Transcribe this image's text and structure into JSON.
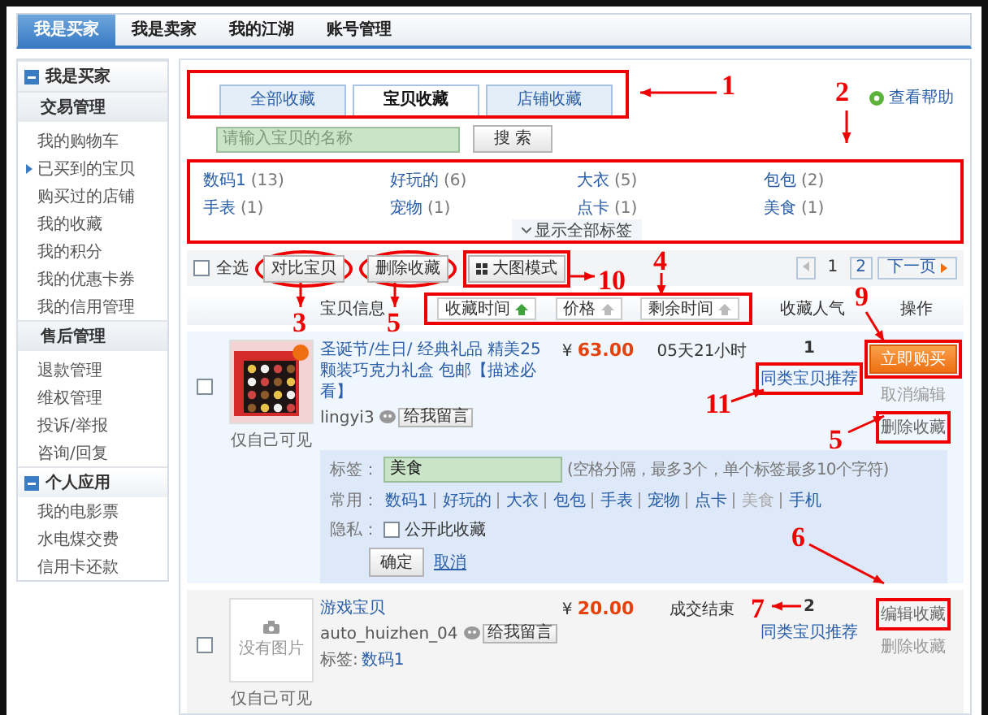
{
  "top_nav": [
    {
      "label": "我是买家",
      "selected": true
    },
    {
      "label": "我是卖家",
      "selected": false
    },
    {
      "label": "我的江湖",
      "selected": false
    },
    {
      "label": "账号管理",
      "selected": false
    }
  ],
  "sidebar": [
    {
      "title": "我是买家",
      "kind": "section"
    },
    {
      "title": "交易管理",
      "kind": "group",
      "items": [
        {
          "label": "我的购物车",
          "expandable": false
        },
        {
          "label": "已买到的宝贝",
          "expandable": true
        },
        {
          "label": "购买过的店铺",
          "expandable": false
        },
        {
          "label": "我的收藏",
          "expandable": false
        },
        {
          "label": "我的积分",
          "expandable": false
        },
        {
          "label": "我的优惠卡券",
          "expandable": false
        },
        {
          "label": "我的信用管理",
          "expandable": false
        }
      ]
    },
    {
      "title": "售后管理",
      "kind": "group",
      "items": [
        {
          "label": "退款管理",
          "expandable": false
        },
        {
          "label": "维权管理",
          "expandable": false
        },
        {
          "label": "投诉/举报",
          "expandable": false
        },
        {
          "label": "咨询/回复",
          "expandable": false
        }
      ]
    },
    {
      "title": "个人应用",
      "kind": "section",
      "items": [
        {
          "label": "我的电影票",
          "expandable": false
        },
        {
          "label": "水电煤交费",
          "expandable": false
        },
        {
          "label": "信用卡还款",
          "expandable": false
        }
      ]
    }
  ],
  "tabs": [
    {
      "label": "全部收藏",
      "selected": false
    },
    {
      "label": "宝贝收藏",
      "selected": true
    },
    {
      "label": "店铺收藏",
      "selected": false
    }
  ],
  "help_link": "查看帮助",
  "search": {
    "placeholder": "请输入宝贝的名称",
    "button": "搜 索"
  },
  "tag_filters": [
    {
      "name": "数码1",
      "count": "(13)"
    },
    {
      "name": "好玩的",
      "count": "(6)"
    },
    {
      "name": "大衣",
      "count": "(5)"
    },
    {
      "name": "包包",
      "count": "(2)"
    },
    {
      "name": "手表",
      "count": "(1)"
    },
    {
      "name": "宠物",
      "count": "(1)"
    },
    {
      "name": "点卡",
      "count": "(1)"
    },
    {
      "name": "美食",
      "count": "(1)"
    }
  ],
  "show_all_tags": "显示全部标签",
  "toolbar": {
    "select_all": {
      "label": "全选",
      "checked": false
    },
    "compare": "对比宝贝",
    "delete": "删除收藏",
    "big_view": "大图模式"
  },
  "pagination": {
    "pages": [
      {
        "label": "1",
        "selected": true
      },
      {
        "label": "2",
        "selected": false
      }
    ],
    "next": "下一页"
  },
  "header": {
    "info": "宝贝信息",
    "sorts": [
      {
        "label": "收藏时间",
        "active": true
      },
      {
        "label": "价格",
        "active": false
      },
      {
        "label": "剩余时间",
        "active": false
      }
    ],
    "popularity": "收藏人气",
    "actions": "操作"
  },
  "items": [
    {
      "checked": false,
      "picture": {
        "kind": "picture"
      },
      "visibility": "仅自己可见",
      "title": "圣诞节/生日/ 经典礼品 精美25颗装巧克力礼盒 包邮【描述必看】",
      "seller": "lingyi3",
      "message": "给我留言",
      "currency": "¥",
      "price": "63.00",
      "time": "05天21小时",
      "count": "1",
      "similar": "同类宝贝推荐",
      "actions": [
        {
          "label": "立即购买",
          "kind": "buy"
        },
        {
          "label": "取消编辑",
          "kind": "muted"
        },
        {
          "label": "删除收藏",
          "kind": "link"
        }
      ],
      "editor": {
        "tag_label": "标签：",
        "tag_value": "美食",
        "hint": "(空格分隔，最多3个，单个标签最多10个字符)",
        "common_label": "常用：",
        "common_tags": [
          {
            "label": "数码1",
            "used": false
          },
          {
            "label": "好玩的",
            "used": false
          },
          {
            "label": "大衣",
            "used": false
          },
          {
            "label": "包包",
            "used": false
          },
          {
            "label": "手表",
            "used": false
          },
          {
            "label": "宠物",
            "used": false
          },
          {
            "label": "点卡",
            "used": false
          },
          {
            "label": "美食",
            "used": true
          },
          {
            "label": "手机",
            "used": false
          }
        ],
        "privacy_label": "隐私：",
        "public": {
          "label": "公开此收藏",
          "checked": false
        },
        "ok": "确定",
        "cancel": "取消"
      }
    },
    {
      "checked": false,
      "picture": {
        "kind": "none",
        "label": "没有图片"
      },
      "visibility": "仅自己可见",
      "title": "游戏宝贝",
      "seller": "auto_huizhen_04",
      "message": "给我留言",
      "tags_label": "标签:",
      "tags_value": "数码1",
      "currency": "¥",
      "price": "20.00",
      "time": "成交结束",
      "count": "2",
      "similar": "同类宝贝推荐",
      "actions": [
        {
          "label": "编辑收藏",
          "kind": "link"
        },
        {
          "label": "删除收藏",
          "kind": "muted"
        }
      ]
    }
  ],
  "annotations": [
    {
      "label": "1"
    },
    {
      "label": "2"
    },
    {
      "label": "3"
    },
    {
      "label": "5"
    },
    {
      "label": "10"
    },
    {
      "label": "4"
    },
    {
      "label": "9"
    },
    {
      "label": "11"
    },
    {
      "label": "5"
    },
    {
      "label": "6"
    },
    {
      "label": "7"
    }
  ]
}
